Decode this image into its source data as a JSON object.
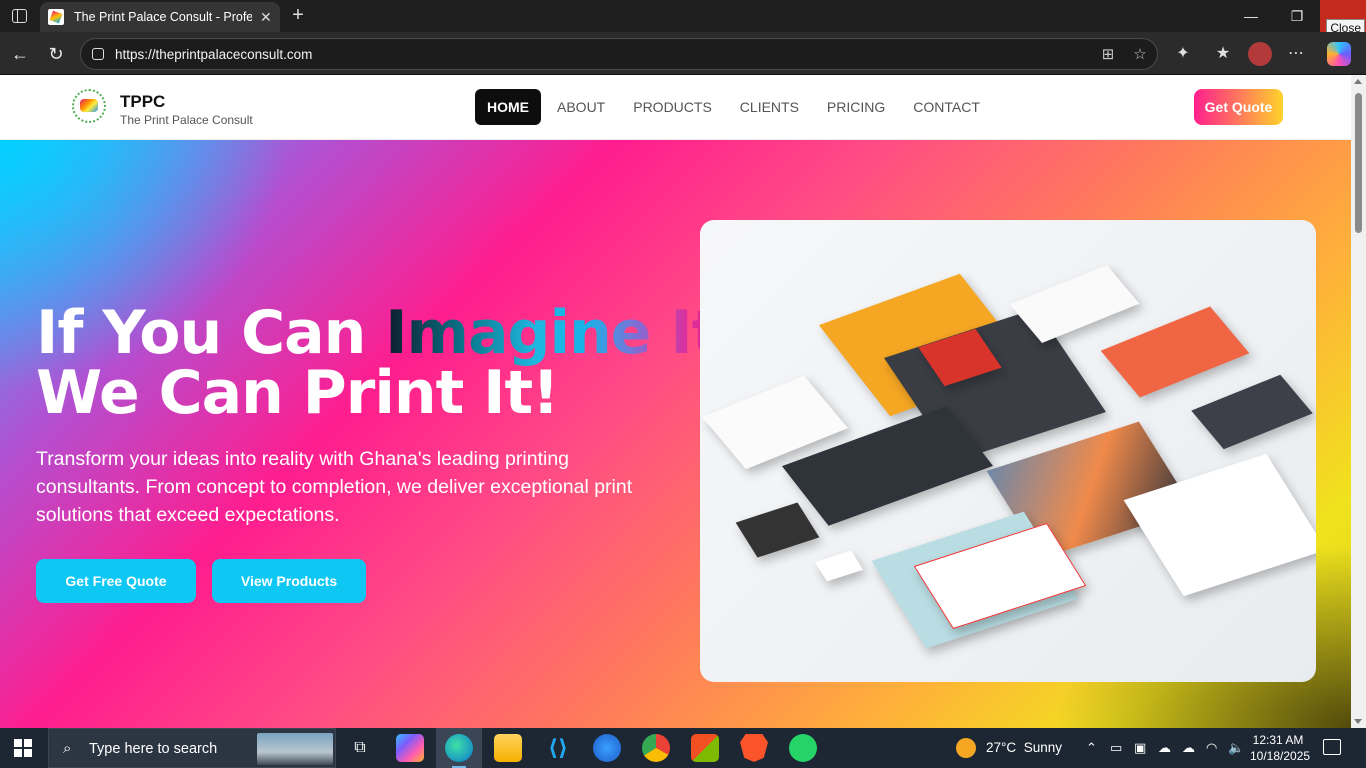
{
  "browser": {
    "tab_title": "The Print Palace Consult - Profess",
    "url": "https://theprintpalaceconsult.com",
    "close_tooltip": "Close"
  },
  "site": {
    "brand": {
      "name": "TPPC",
      "subtitle": "The Print Palace Consult"
    },
    "nav": {
      "items": [
        {
          "label": "HOME",
          "active": true
        },
        {
          "label": "ABOUT",
          "active": false
        },
        {
          "label": "PRODUCTS",
          "active": false
        },
        {
          "label": "CLIENTS",
          "active": false
        },
        {
          "label": "PRICING",
          "active": false
        },
        {
          "label": "CONTACT",
          "active": false
        }
      ],
      "cta": "Get Quote"
    },
    "hero": {
      "title_part1": "If You Can ",
      "title_highlight": "Imagine It",
      "title_comma": ",",
      "title_line2": "We Can Print It!",
      "text": "Transform your ideas into reality with Ghana's leading printing consultants. From concept to completion, we deliver exceptional print solutions that exceed expectations.",
      "buttons": {
        "primary": "Get Free Quote",
        "secondary": "View Products"
      }
    },
    "colors": {
      "accent": "#0fc7f3",
      "pink": "#ff1d8e",
      "yellow": "#ffd22b",
      "dark": "#0d0d0d"
    }
  },
  "taskbar": {
    "search_placeholder": "Type here to search",
    "weather": {
      "temp": "27°C",
      "condition": "Sunny"
    },
    "clock": {
      "time": "12:31 AM",
      "date": "10/18/2025"
    },
    "apps": [
      "task-view-icon",
      "copilot-icon",
      "edge-icon",
      "file-explorer-icon",
      "vscode-icon",
      "firefox-icon",
      "chrome-icon",
      "store-icon",
      "brave-icon",
      "whatsapp-icon"
    ]
  }
}
